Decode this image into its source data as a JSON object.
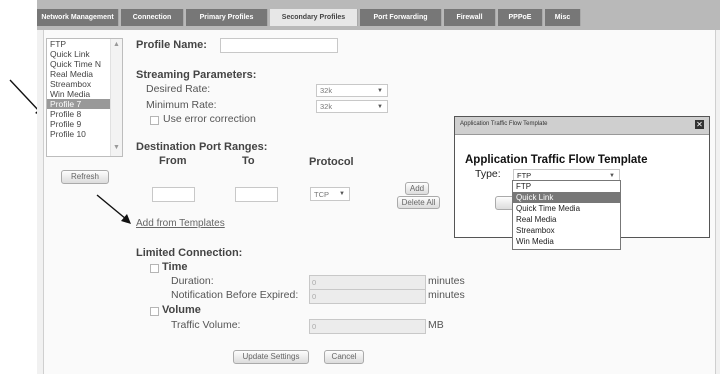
{
  "tabs": [
    {
      "label": "Network Management"
    },
    {
      "label": "Connection"
    },
    {
      "label": "Primary Profiles"
    },
    {
      "label": "Secondary Profiles"
    },
    {
      "label": "Port Forwarding"
    },
    {
      "label": "Firewall"
    },
    {
      "label": "PPPoE"
    },
    {
      "label": "Misc"
    }
  ],
  "profile_list": {
    "items": [
      {
        "label": "FTP"
      },
      {
        "label": "Quick Link"
      },
      {
        "label": "Quick Time N"
      },
      {
        "label": "Real Media"
      },
      {
        "label": "Streambox"
      },
      {
        "label": "Win Media"
      },
      {
        "label": "Profile 7"
      },
      {
        "label": "Profile 8"
      },
      {
        "label": "Profile 9"
      },
      {
        "label": "Profile 10"
      }
    ],
    "selected": "Profile 7",
    "refresh_label": "Refresh"
  },
  "form": {
    "profile_name_label": "Profile Name:",
    "streaming_heading": "Streaming Parameters:",
    "desired_rate_label": "Desired Rate:",
    "desired_rate_value": "32k",
    "minimum_rate_label": "Minimum Rate:",
    "minimum_rate_value": "32k",
    "error_correction_label": "Use error correction",
    "dest_port_heading": "Destination Port Ranges:",
    "col_from": "From",
    "col_to": "To",
    "col_protocol": "Protocol",
    "protocol_value": "TCP",
    "add_label": "Add",
    "delete_all_label": "Delete All",
    "add_from_templates": "Add from Templates",
    "limited_heading": "Limited Connection:",
    "time_label": "Time",
    "duration_label": "Duration:",
    "duration_value": "0",
    "duration_unit": "minutes",
    "notification_label": "Notification Before Expired:",
    "notification_value": "0",
    "notification_unit": "minutes",
    "volume_label": "Volume",
    "traffic_label": "Traffic Volume:",
    "traffic_value": "0",
    "traffic_unit": "MB",
    "update_label": "Update Settings",
    "cancel_label": "Cancel"
  },
  "dialog": {
    "window_title": "Application Traffic Flow Template",
    "heading": "Application Traffic Flow Template",
    "type_label": "Type:",
    "type_value": "FTP",
    "close_icon": "close-icon",
    "options": [
      {
        "label": "FTP"
      },
      {
        "label": "Quick Link"
      },
      {
        "label": "Quick Time Media"
      },
      {
        "label": "Real Media"
      },
      {
        "label": "Streambox"
      },
      {
        "label": "Win Media"
      }
    ],
    "highlighted": "Quick Link"
  }
}
